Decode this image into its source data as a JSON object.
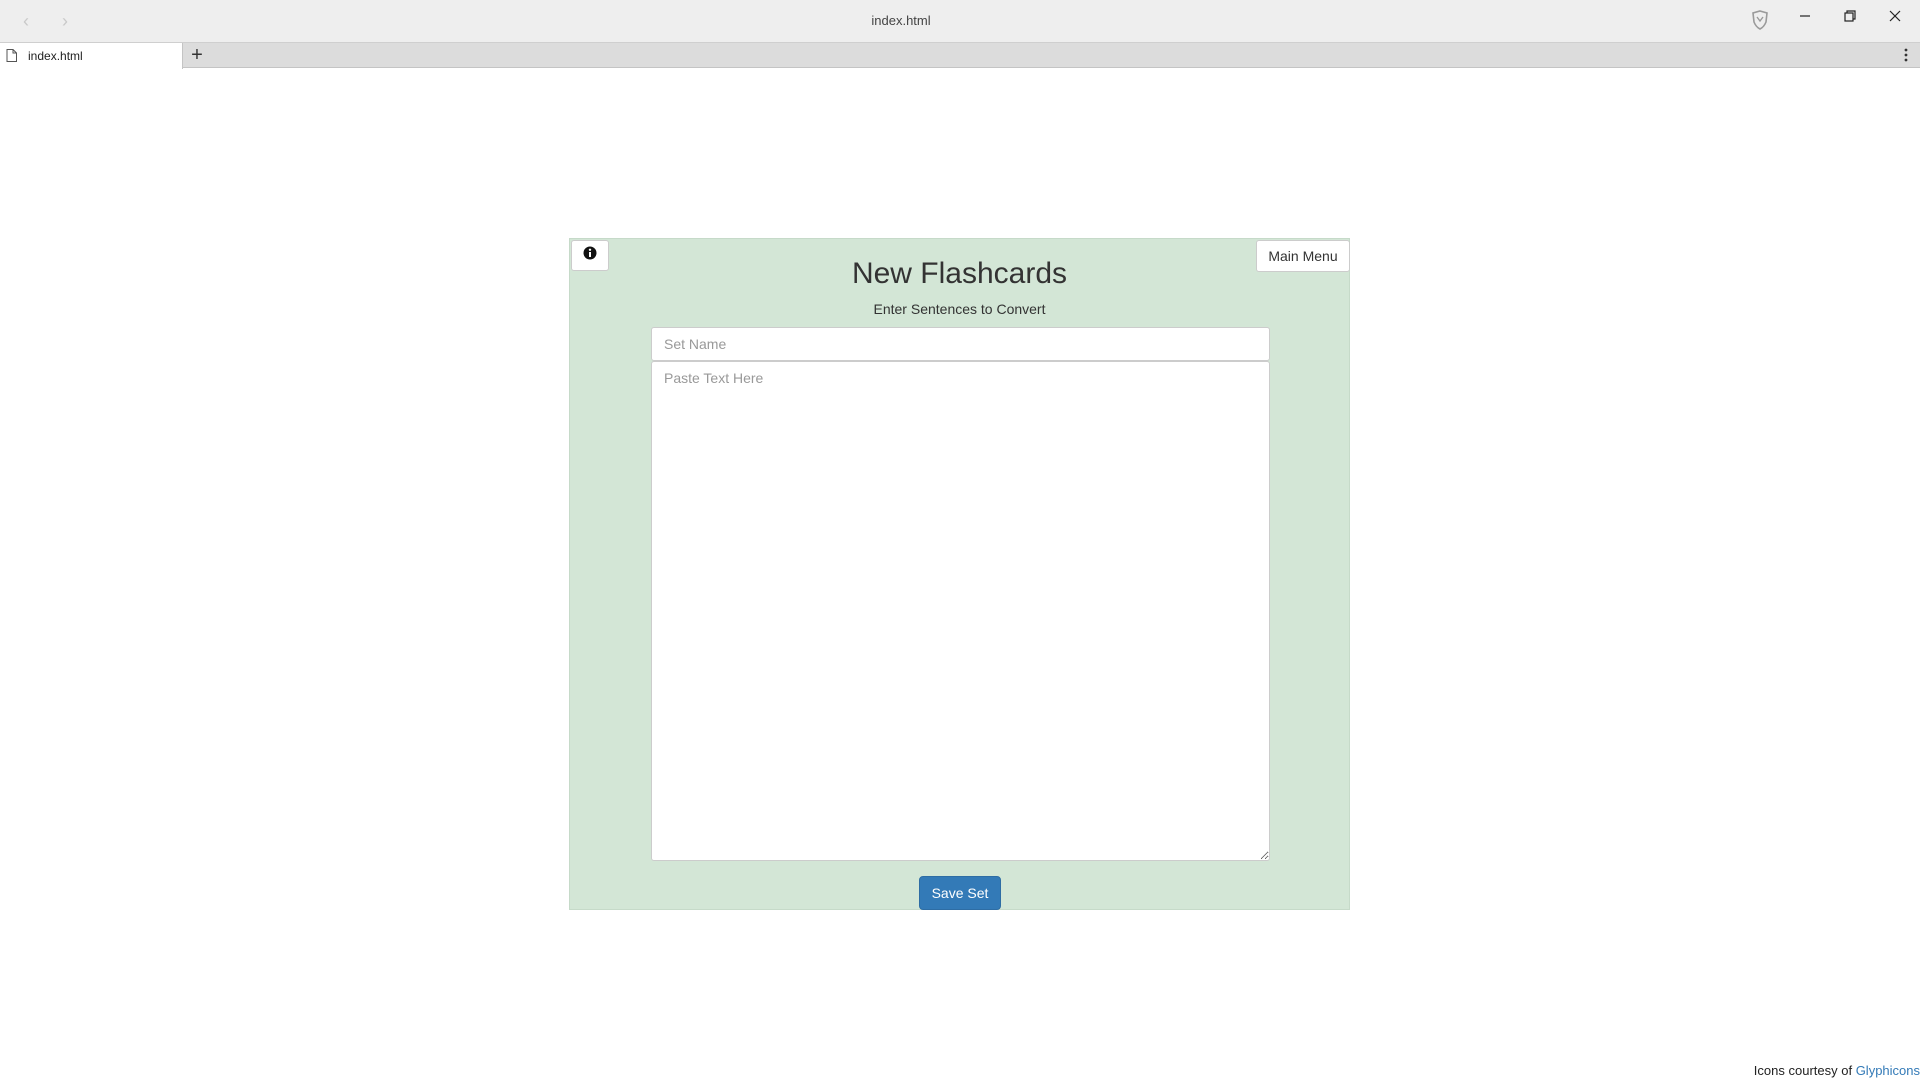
{
  "window": {
    "title": "index.html",
    "back_icon": "chevron-left-icon",
    "forward_icon": "chevron-right-icon",
    "brave_icon": "brave-shield-icon",
    "controls": {
      "minimize": "minimize-icon",
      "restore": "restore-icon",
      "close": "close-icon"
    }
  },
  "tabs": {
    "items": [
      {
        "label": "index.html",
        "icon": "page-icon"
      }
    ],
    "new_tab_icon": "plus-icon",
    "menu_icon": "vertical-ellipsis-icon"
  },
  "card": {
    "info_icon": "info-sign-icon",
    "main_menu_label": "Main Menu",
    "title": "New Flashcards",
    "subtitle": "Enter Sentences to Convert",
    "set_name": {
      "value": "",
      "placeholder": "Set Name"
    },
    "paste_text": {
      "value": "",
      "placeholder": "Paste Text Here"
    },
    "save_label": "Save Set"
  },
  "footer": {
    "credit_prefix": "Icons courtesy of ",
    "credit_link": "Glyphicons"
  },
  "colors": {
    "card_background": "#d3e6d6",
    "primary_button": "#337ab7",
    "link": "#337ab7"
  }
}
